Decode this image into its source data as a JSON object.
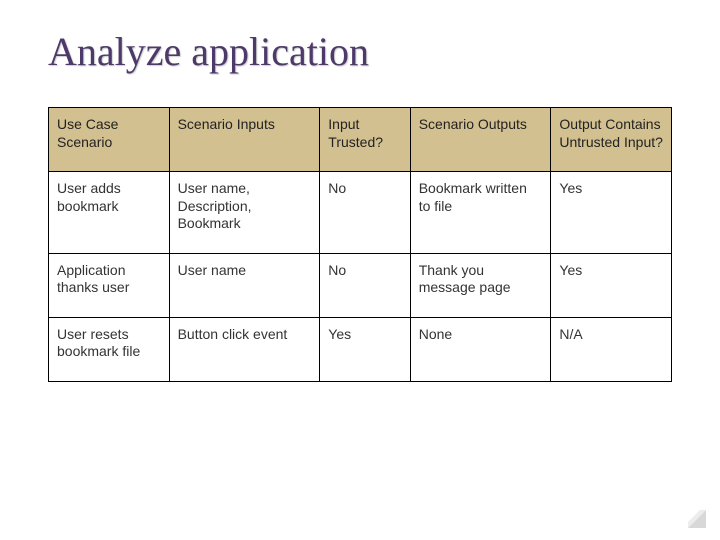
{
  "title": "Analyze application",
  "table": {
    "headers": [
      "Use Case Scenario",
      "Scenario Inputs",
      "Input Trusted?",
      "Scenario Outputs",
      "Output Contains Untrusted Input?"
    ],
    "rows": [
      {
        "use_case": "User adds bookmark",
        "inputs": "User name, Description, Bookmark",
        "trusted": "No",
        "outputs": "Bookmark written to file",
        "untrusted": "Yes"
      },
      {
        "use_case": "Application thanks user",
        "inputs": "User name",
        "trusted": "No",
        "outputs": "Thank you message page",
        "untrusted": "Yes"
      },
      {
        "use_case": "User resets bookmark file",
        "inputs": "Button click event",
        "trusted": "Yes",
        "outputs": "None",
        "untrusted": "N/A"
      }
    ]
  }
}
